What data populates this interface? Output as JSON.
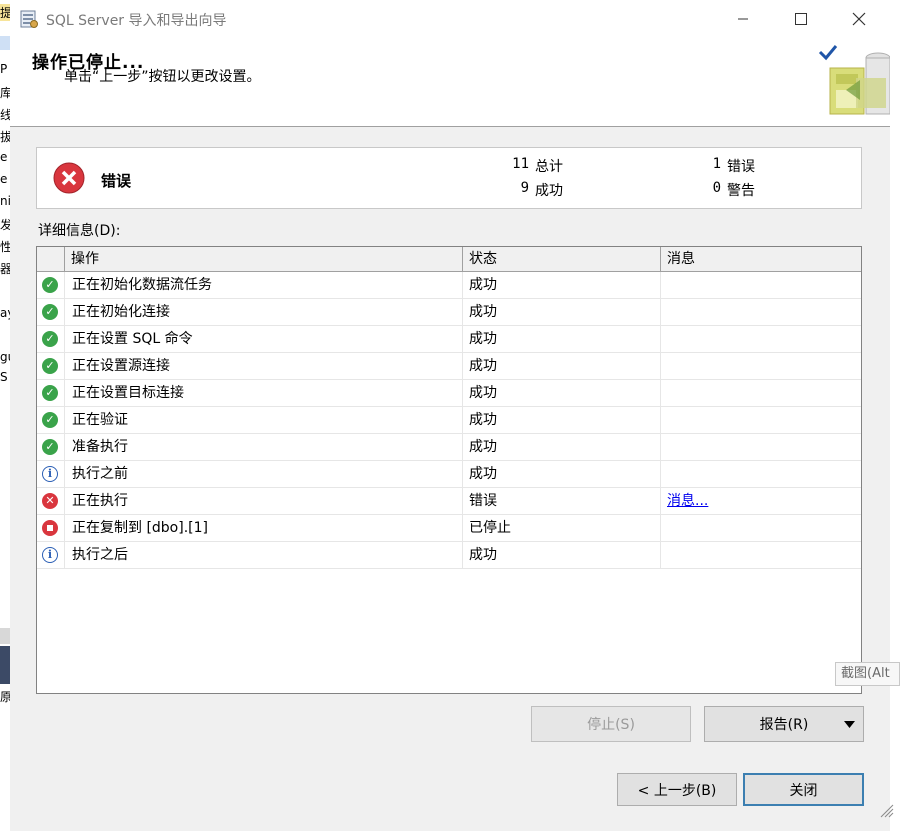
{
  "window": {
    "title": "SQL Server 导入和导出向导"
  },
  "header": {
    "title": "操作已停止...",
    "subtitle": "单击“上一步”按钮以更改设置。"
  },
  "summary": {
    "status_label": "错误",
    "total_count": "11",
    "total_label": "总计",
    "success_count": "9",
    "success_label": "成功",
    "error_count": "1",
    "error_label": "错误",
    "warning_count": "0",
    "warning_label": "警告"
  },
  "details": {
    "label": "详细信息(D):",
    "columns": [
      "操作",
      "状态",
      "消息"
    ],
    "rows": [
      {
        "icon": "success-icon",
        "action": "正在初始化数据流任务",
        "status": "成功",
        "message": ""
      },
      {
        "icon": "success-icon",
        "action": "正在初始化连接",
        "status": "成功",
        "message": ""
      },
      {
        "icon": "success-icon",
        "action": "正在设置 SQL 命令",
        "status": "成功",
        "message": ""
      },
      {
        "icon": "success-icon",
        "action": "正在设置源连接",
        "status": "成功",
        "message": ""
      },
      {
        "icon": "success-icon",
        "action": "正在设置目标连接",
        "status": "成功",
        "message": ""
      },
      {
        "icon": "success-icon",
        "action": "正在验证",
        "status": "成功",
        "message": ""
      },
      {
        "icon": "success-icon",
        "action": "准备执行",
        "status": "成功",
        "message": ""
      },
      {
        "icon": "info-icon",
        "action": "执行之前",
        "status": "成功",
        "message": ""
      },
      {
        "icon": "error-icon",
        "action": "正在执行",
        "status": "错误",
        "message": "消息..."
      },
      {
        "icon": "stop-icon",
        "action": "正在复制到 [dbo].[1]",
        "status": "已停止",
        "message": ""
      },
      {
        "icon": "info-icon",
        "action": "执行之后",
        "status": "成功",
        "message": ""
      }
    ]
  },
  "buttons": {
    "stop": "停止(S)",
    "report": "报告(R)",
    "back": "< 上一步(B)",
    "close": "关闭"
  },
  "tooltip": "截图(Alt",
  "background_fragments": [
    "提",
    "P",
    "库",
    "线",
    "拔",
    "e",
    "e",
    "ni",
    "发",
    "性",
    "器",
    "ay",
    "gu",
    "S",
    "原"
  ],
  "colors": {
    "success": "#3aa34a",
    "error": "#d9363e",
    "info": "#2b5fb5",
    "link": "#0000ee",
    "default_button_border": "#3c7fb1"
  }
}
